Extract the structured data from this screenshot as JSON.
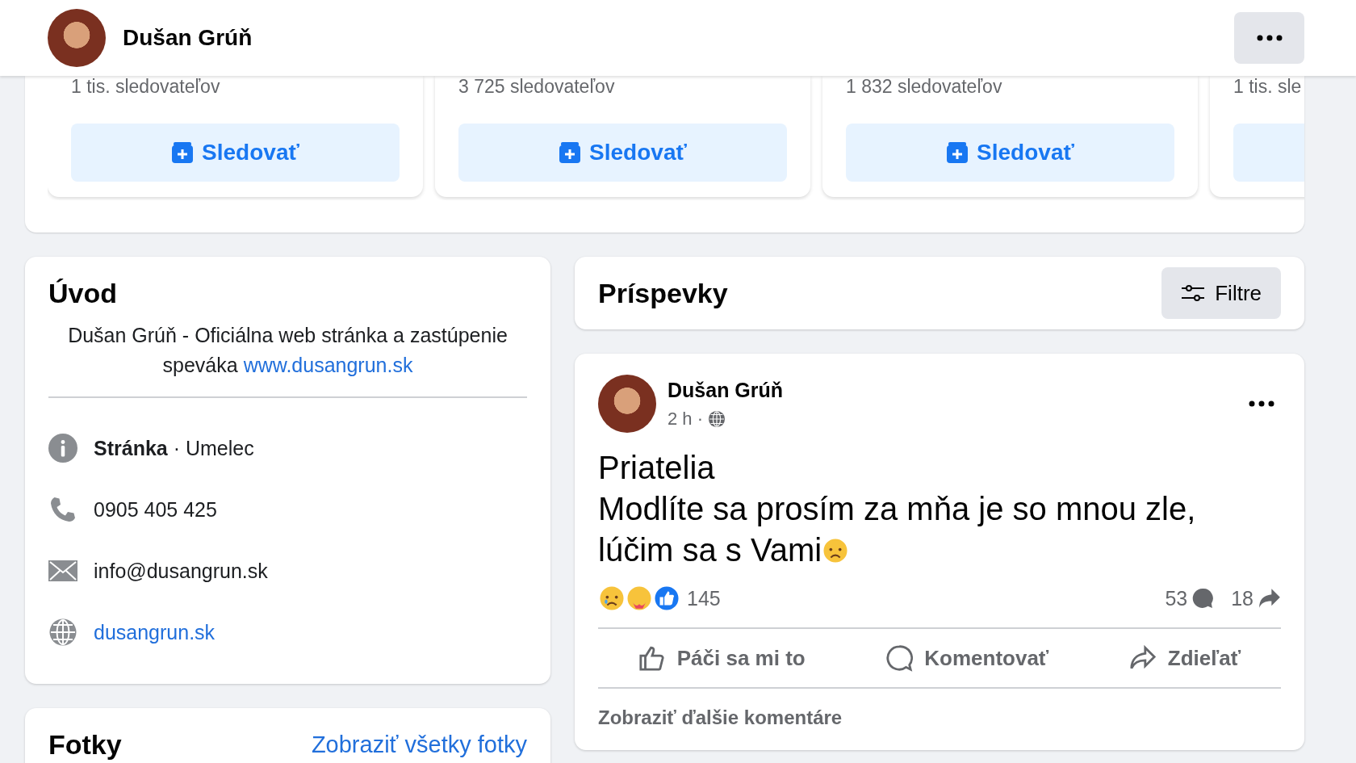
{
  "header": {
    "name": "Dušan Grúň"
  },
  "suggested_pages": [
    {
      "followers": "1 tis. sledovateľov",
      "button": "Sledovať"
    },
    {
      "followers": "3 725 sledovateľov",
      "button": "Sledovať"
    },
    {
      "followers": "1 832 sledovateľov",
      "button": "Sledovať"
    },
    {
      "followers": "1 tis. sle"
    }
  ],
  "intro": {
    "title": "Úvod",
    "bio": "Dušan Grúň - Oficiálna web stránka a zastúpenie speváka",
    "bio_link": "www.dusangrun.sk",
    "details": [
      {
        "kind": "category",
        "text": "**Stránka** · Umelec"
      },
      {
        "kind": "phone",
        "text": "0905 405 425"
      },
      {
        "kind": "email",
        "text": "info@dusangrun.sk"
      },
      {
        "kind": "website",
        "text": "dusangrun.sk"
      }
    ]
  },
  "photos": {
    "title": "Fotky",
    "link": "Zobraziť všetky fotky"
  },
  "posts_header": {
    "title": "Príspevky",
    "filter_button": "Filtre"
  },
  "post": {
    "author": "Dušan Grúň",
    "time": "2 h ·",
    "lines": [
      "Priatelia",
      "Modlíte sa prosím za mňa je so mnou zle,",
      "lúčim sa s Vami"
    ],
    "reaction_count": "145",
    "comment_count": "53",
    "share_count": "18",
    "actions": [
      {
        "kind": "like",
        "label": "Páči sa mi to"
      },
      {
        "kind": "comment",
        "label": "Komentovať"
      },
      {
        "kind": "share",
        "label": "Zdieľať"
      }
    ],
    "more_comments": "Zobraziť ďalšie komentáre"
  }
}
